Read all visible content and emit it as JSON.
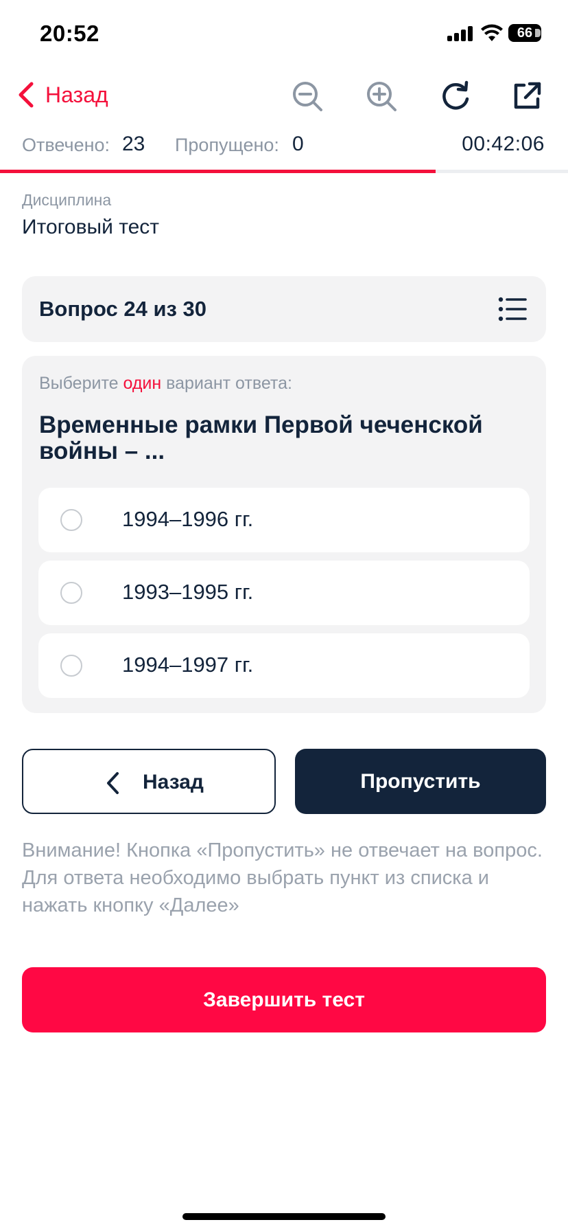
{
  "status_bar": {
    "time": "20:52",
    "battery": "66",
    "icons": [
      "signal-icon",
      "wifi-icon",
      "battery-icon"
    ]
  },
  "nav": {
    "back_label": "Назад",
    "tools": [
      "zoom-out-icon",
      "zoom-in-icon",
      "refresh-icon",
      "external-link-icon"
    ]
  },
  "counters": {
    "answered_label": "Отвечено:",
    "answered_value": "23",
    "skipped_label": "Пропущено:",
    "skipped_value": "0",
    "timer": "00:42:06"
  },
  "progress": {
    "fraction": 0.767
  },
  "discipline": {
    "label": "Дисциплина",
    "name": "Итоговый тест"
  },
  "question": {
    "number_label": "Вопрос 24 из 30",
    "hint_prefix": "Выберите",
    "hint_accent": "один",
    "hint_suffix": "вариант ответа:",
    "text": "Временные рамки Первой чеченской войны – ...",
    "options": [
      {
        "label": "1994–1996 гг.",
        "selected": false
      },
      {
        "label": "1993–1995 гг.",
        "selected": false
      },
      {
        "label": "1994–1997 гг.",
        "selected": false
      }
    ]
  },
  "buttons": {
    "back": "Назад",
    "skip": "Пропустить",
    "finish": "Завершить тест"
  },
  "warning": "Внимание! Кнопка «Пропустить» не отвечает на вопрос. Для ответа необходимо выбрать пункт из списка и нажать кнопку «Далее»",
  "colors": {
    "accent": "#f4103b",
    "primary_dark": "#13243b",
    "finish_button": "#ff0844",
    "muted_text": "#8c96a3",
    "card_bg": "#f3f3f4"
  }
}
